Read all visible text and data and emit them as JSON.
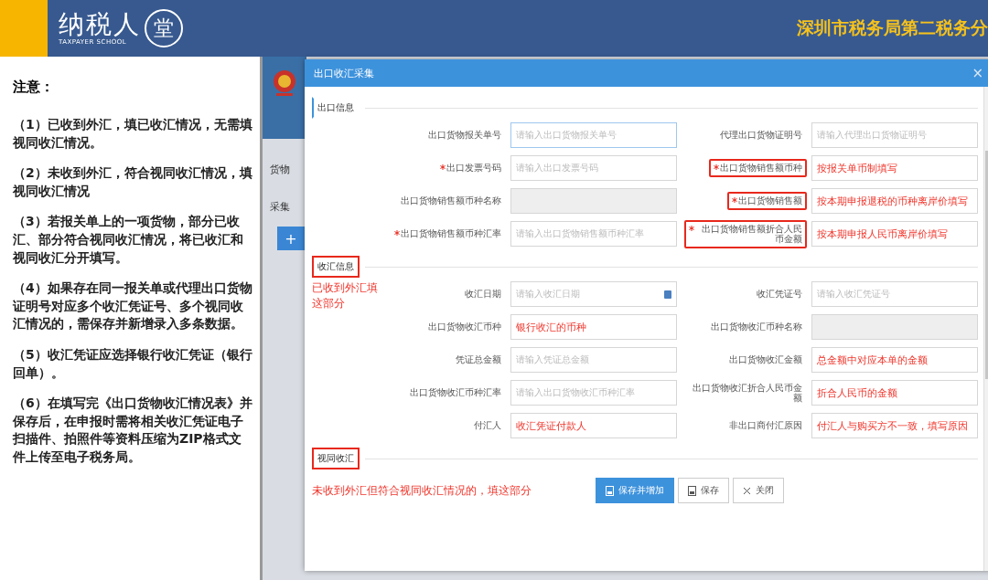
{
  "header": {
    "logo": "纳税人",
    "logo_mark": "堂",
    "logo_subtitle": "TAXPAYER SCHOOL",
    "banner": "深圳市税务局第二税务分"
  },
  "notes": {
    "title": "注意：",
    "items": [
      "（1）已收到外汇，填已收汇情况，无需填视同收汇情况。",
      "（2）未收到外汇，符合视同收汇情况，填视同收汇情况",
      "（3）若报关单上的一项货物，部分已收汇、部分符合视同收汇情况，将已收汇和视同收汇**分开填写**。",
      "（4）如果存在同一报关单或代理出口货物证明号**对应多个收汇凭证号、多个视同收汇情况**的，需**保存并新增录入多条数据**。",
      "（5）收汇凭证应选择**银行收汇凭证（银行回单）**。",
      "（6）在填写完《出口货物收汇情况表》并保存后，在申报时需将相关收汇凭证电子扫描件、拍照件等资料压缩为ZIP格式文件**上传至电子税务局**。"
    ]
  },
  "background_app": {
    "sidebar_texts": [
      "货物",
      "采集"
    ],
    "add_button": "+"
  },
  "dialog": {
    "title": "出口收汇采集",
    "close": "×",
    "sections": [
      {
        "title": "出口信息",
        "highlighted": false,
        "fields": [
          {
            "kind": "text",
            "label": "出口货物报关单号",
            "required": false,
            "label_highlighted": false,
            "placeholder": "请输入出口货物报关单号"
          },
          {
            "kind": "text",
            "label": "代理出口货物证明号",
            "required": false,
            "label_highlighted": false,
            "placeholder": "请输入代理出口货物证明号"
          },
          {
            "kind": "text",
            "label": "出口发票号码",
            "required": true,
            "label_highlighted": false,
            "placeholder": "请输入出口发票号码"
          },
          {
            "kind": "text",
            "label": "出口货物销售额币种",
            "required": true,
            "label_highlighted": true,
            "annotation": "按报关单币制填写"
          },
          {
            "kind": "readonly",
            "label": "出口货物销售额币种名称",
            "required": false,
            "label_highlighted": false
          },
          {
            "kind": "text",
            "label": "出口货物销售额",
            "required": true,
            "label_highlighted": true,
            "annotation": "按本期申报退税的币种离岸价填写"
          },
          {
            "kind": "text",
            "label": "出口货物销售额币种汇率",
            "required": true,
            "label_highlighted": false,
            "placeholder": "请输入出口货物销售额币种汇率"
          },
          {
            "kind": "text",
            "label": "出口货物销售额折合人民币金额",
            "required": true,
            "label_highlighted": true,
            "annotation": "按本期申报人民币离岸价填写"
          }
        ]
      },
      {
        "title": "收汇信息",
        "highlighted": true,
        "note": "已收到外汇填这部分",
        "fields": [
          {
            "kind": "date",
            "label": "收汇日期",
            "required": false,
            "label_highlighted": false,
            "placeholder": "请输入收汇日期"
          },
          {
            "kind": "text",
            "label": "收汇凭证号",
            "required": false,
            "label_highlighted": false,
            "placeholder": "请输入收汇凭证号"
          },
          {
            "kind": "text",
            "label": "出口货物收汇币种",
            "required": false,
            "label_highlighted": false,
            "annotation": "银行收汇的币种"
          },
          {
            "kind": "readonly",
            "label": "出口货物收汇币种名称",
            "required": false,
            "label_highlighted": false
          },
          {
            "kind": "text",
            "label": "凭证总金额",
            "required": false,
            "label_highlighted": false,
            "placeholder": "请输入凭证总金额"
          },
          {
            "kind": "text",
            "label": "出口货物收汇金额",
            "required": false,
            "label_highlighted": false,
            "annotation": "总金额中对应本单的金额"
          },
          {
            "kind": "text",
            "label": "出口货物收汇币种汇率",
            "required": false,
            "label_highlighted": false,
            "placeholder": "请输入出口货物收汇币种汇率"
          },
          {
            "kind": "text",
            "label": "出口货物收汇折合人民币金额",
            "required": false,
            "label_highlighted": false,
            "annotation": "折合人民币的金额"
          },
          {
            "kind": "text",
            "label": "付汇人",
            "required": false,
            "label_highlighted": false,
            "annotation": "收汇凭证付款人"
          },
          {
            "kind": "text",
            "label": "非出口商付汇原因",
            "required": false,
            "label_highlighted": false,
            "annotation": "付汇人与购买方不一致，填写原因"
          }
        ]
      },
      {
        "title": "视同收汇",
        "highlighted": true,
        "note": "未收到外汇但符合视同收汇情况的，填这部分"
      }
    ],
    "buttons": [
      {
        "kind": "save-add",
        "label": "保存并增加",
        "primary": true
      },
      {
        "kind": "save",
        "label": "保存",
        "primary": false
      },
      {
        "kind": "close",
        "label": "关闭",
        "primary": false
      }
    ]
  }
}
